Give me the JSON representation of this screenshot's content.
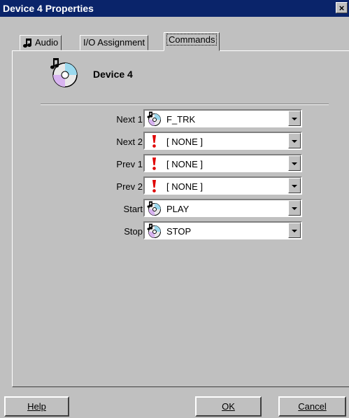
{
  "window": {
    "title": "Device 4 Properties",
    "close_glyph": "×"
  },
  "tabs": [
    {
      "label": "Audio",
      "icon": "music-note-icon"
    },
    {
      "label": "I/O Assignment"
    },
    {
      "label": "Commands",
      "active": true
    }
  ],
  "device": {
    "name": "Device 4",
    "icon": "cd-music-icon"
  },
  "commands": [
    {
      "label": "Next 1",
      "value": "F_TRK",
      "icon": "cd-icon"
    },
    {
      "label": "Next 2",
      "value": "[ NONE ]",
      "icon": "exclamation-icon"
    },
    {
      "label": "Prev 1",
      "value": "[ NONE ]",
      "icon": "exclamation-icon"
    },
    {
      "label": "Prev 2",
      "value": "[ NONE ]",
      "icon": "exclamation-icon"
    },
    {
      "label": "Start",
      "value": "PLAY",
      "icon": "cd-icon"
    },
    {
      "label": "Stop",
      "value": "STOP",
      "icon": "cd-icon"
    }
  ],
  "buttons": {
    "help": "Help",
    "ok": "OK",
    "cancel": "Cancel"
  },
  "colors": {
    "titlebar": "#0a246a",
    "face": "#c0c0c0",
    "warning": "#e00000"
  }
}
